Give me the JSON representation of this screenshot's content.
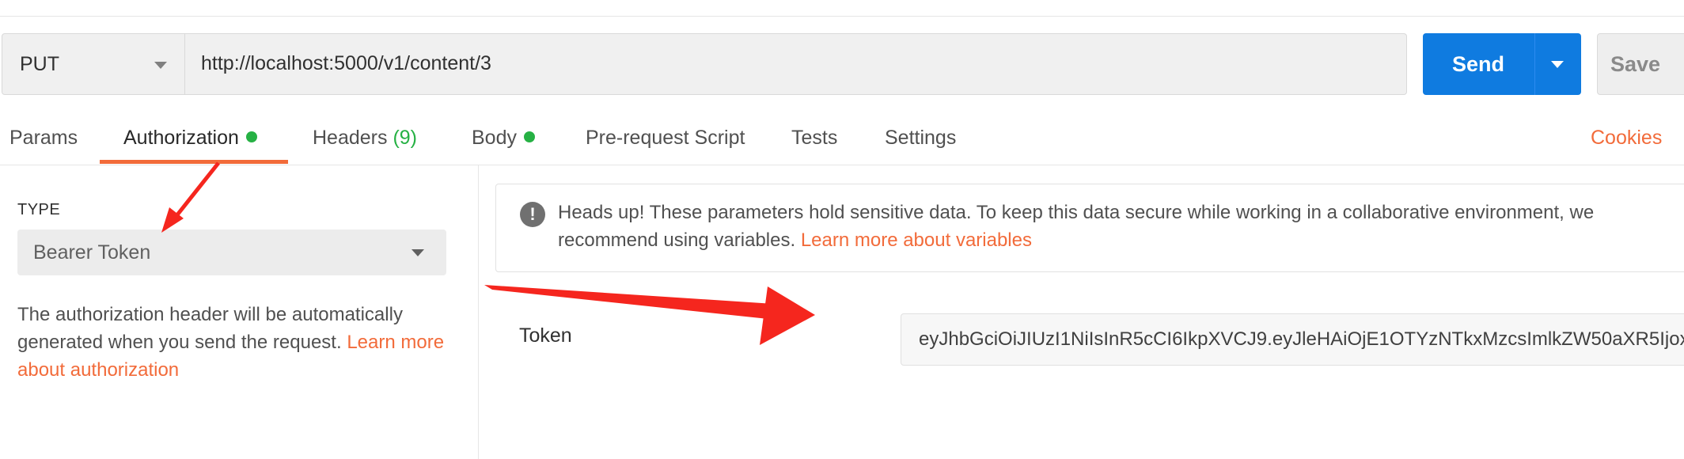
{
  "request": {
    "method": "PUT",
    "url": "http://localhost:5000/v1/content/3",
    "send_label": "Send",
    "save_label": "Save"
  },
  "tabs": [
    {
      "label": "Params"
    },
    {
      "label": "Authorization",
      "dot": true,
      "active": true
    },
    {
      "label": "Headers",
      "count": "(9)"
    },
    {
      "label": "Body",
      "dot": true
    },
    {
      "label": "Pre-request Script"
    },
    {
      "label": "Tests"
    },
    {
      "label": "Settings"
    }
  ],
  "cookies_label": "Cookies",
  "auth": {
    "type_label": "TYPE",
    "type_value": "Bearer Token",
    "description": "The authorization header will be automatically generated when you send the request.",
    "description_link": "Learn more about authorization"
  },
  "notice": {
    "text": "Heads up! These parameters hold sensitive data. To keep this data secure while working in a collaborative environment, we recommend using variables.",
    "link": "Learn more about variables"
  },
  "token": {
    "label": "Token",
    "value": "eyJhbGciOiJIUzI1NiIsInR5cCI6IkpXVCJ9.eyJleHAiOjE1OTYzNTkxMzcsImlkZW50aXR5Ijox ..."
  },
  "colors": {
    "accent": "#f26b3a",
    "send": "#0f7be0",
    "status_dot": "#26b144",
    "annotation_arrow": "#f5261e"
  }
}
